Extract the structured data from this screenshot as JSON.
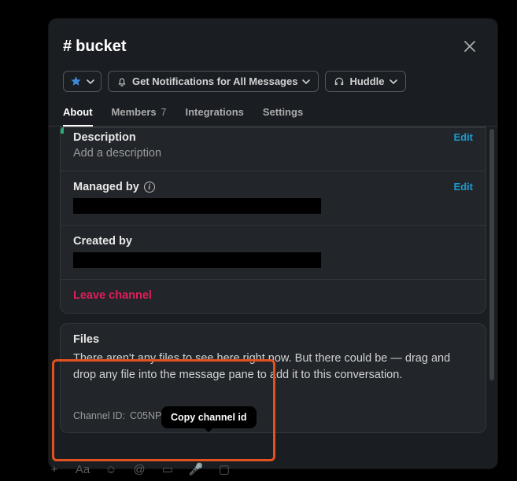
{
  "channel": {
    "hash": "#",
    "name": "bucket"
  },
  "actions": {
    "notifications_label": "Get Notifications for All Messages",
    "huddle_label": "Huddle"
  },
  "tabs": {
    "about": "About",
    "members": "Members",
    "members_count": "7",
    "integrations": "Integrations",
    "settings": "Settings"
  },
  "about": {
    "description_title": "Description",
    "description_placeholder": "Add a description",
    "managed_by_title": "Managed by",
    "created_by_title": "Created by",
    "edit_label": "Edit",
    "leave_label": "Leave channel"
  },
  "files": {
    "title": "Files",
    "empty_text": "There aren't any files to see here right now. But there could be — drag and drop any file into the message pane to add it to this conversation.",
    "channel_id_label": "Channel ID:",
    "channel_id_value": "C05NP1X1VS8"
  },
  "tooltip": {
    "copy_channel_id": "Copy channel id"
  }
}
